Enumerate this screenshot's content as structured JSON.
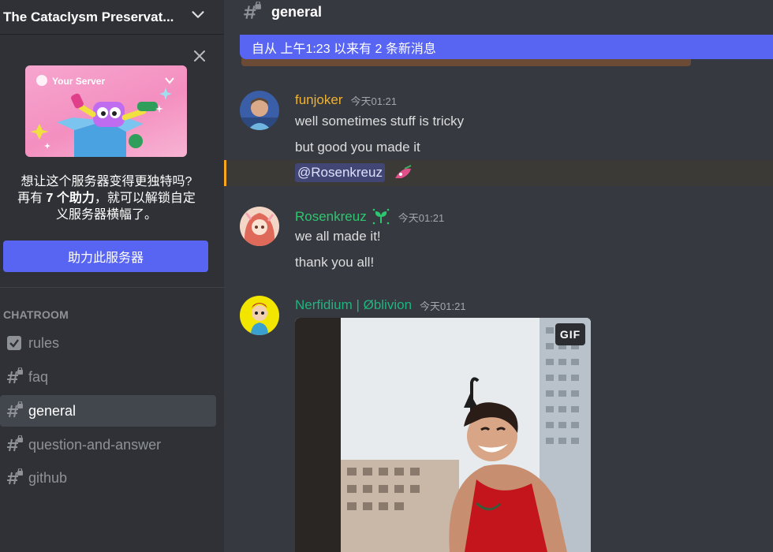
{
  "server": {
    "name": "The Cataclysm Preservat..."
  },
  "boost": {
    "image_label": "Your Server",
    "text_line1": "想让这个服务器变得更独特吗?",
    "text_line2_pre": "再有 ",
    "text_line2_bold": "7 个助力",
    "text_line2_post": "，就可以解锁自定",
    "text_line3": "义服务器横幅了。",
    "button_label": "助力此服务器"
  },
  "sidebar": {
    "category": "CHATROOM",
    "channels": [
      {
        "label": "rules",
        "icon": "rules-checkbox-icon",
        "active": false
      },
      {
        "label": "faq",
        "icon": "hash-lock-icon",
        "active": false
      },
      {
        "label": "general",
        "icon": "hash-lock-icon",
        "active": true
      },
      {
        "label": "question-and-answer",
        "icon": "hash-lock-icon",
        "active": false
      },
      {
        "label": "github",
        "icon": "hash-lock-icon",
        "active": false
      }
    ]
  },
  "channel_header": {
    "title": "general"
  },
  "new_messages_bar": {
    "text": "自从 上午1:23 以来有 2 条新消息"
  },
  "messages": [
    {
      "author": "funjoker",
      "author_color": "#f0b232",
      "timestamp": "今天01:21",
      "lines": [
        "well sometimes stuff is tricky",
        "but good you made it"
      ],
      "mention": "@Rosenkreuz"
    },
    {
      "author": "Rosenkreuz",
      "author_color": "#2dc770",
      "timestamp": "今天01:21",
      "lines": [
        "we all made it!",
        "thank you all!"
      ]
    },
    {
      "author": "Nerfidium | Øblivion",
      "author_color": "#1fb57f",
      "timestamp": "今天01:21",
      "attachment_badge": "GIF"
    }
  ],
  "colors": {
    "accent": "#5865f2",
    "sidebar_bg": "#2f3136",
    "chat_bg": "#36393f",
    "mention_highlight": "#faa81a"
  }
}
